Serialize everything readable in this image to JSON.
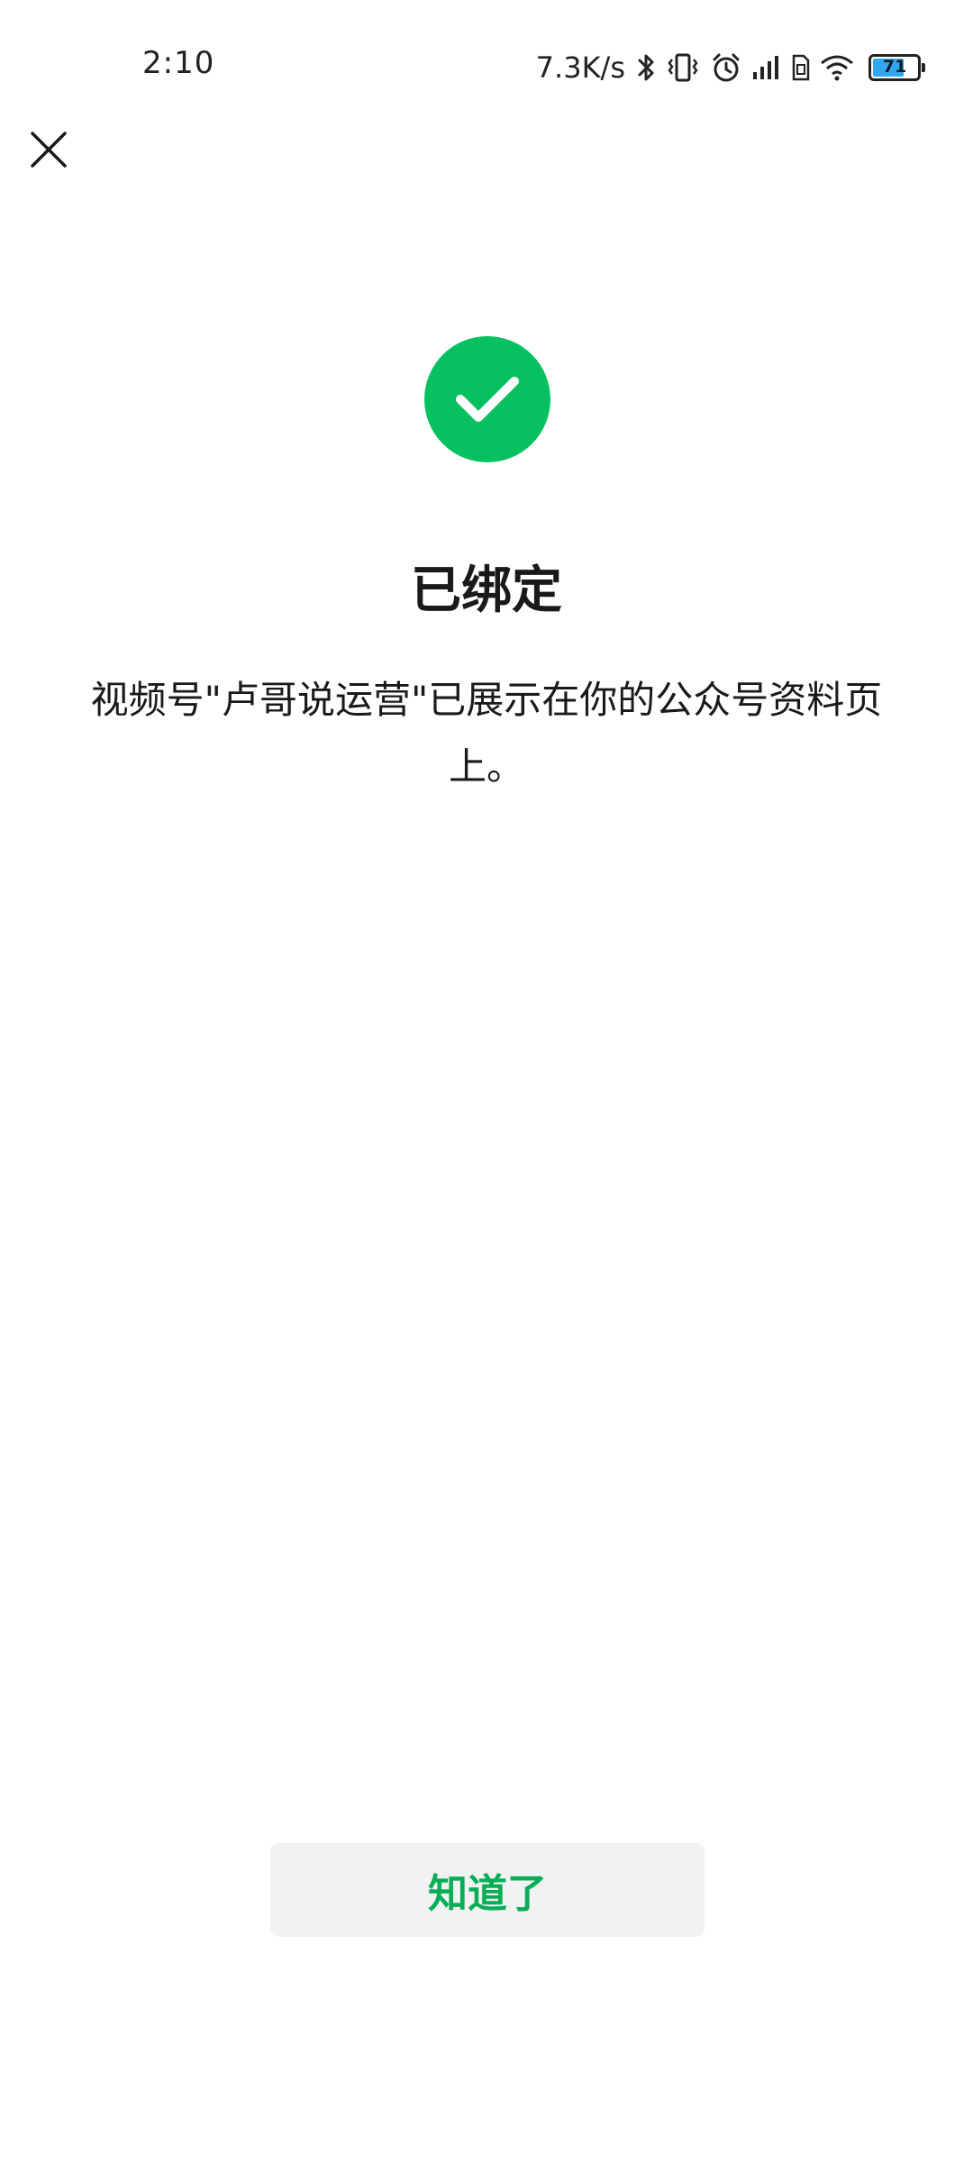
{
  "status_bar": {
    "time": "2:10",
    "net_speed": "7.3K/s",
    "battery_level": "71",
    "battery_fill_fraction": 0.71,
    "icons": [
      "bluetooth-icon",
      "vibrate-icon",
      "alarm-icon",
      "signal-icon",
      "sim-icon",
      "wifi-icon",
      "battery-icon"
    ]
  },
  "header": {
    "close_icon": "close-icon"
  },
  "result": {
    "icon": "success-check-icon",
    "accent_color": "#07c160",
    "title": "已绑定",
    "message": "视频号\"卢哥说运营\"已展示在你的公众号资料页上。"
  },
  "actions": {
    "ok_label": "知道了",
    "ok_color": "#06ae56"
  }
}
